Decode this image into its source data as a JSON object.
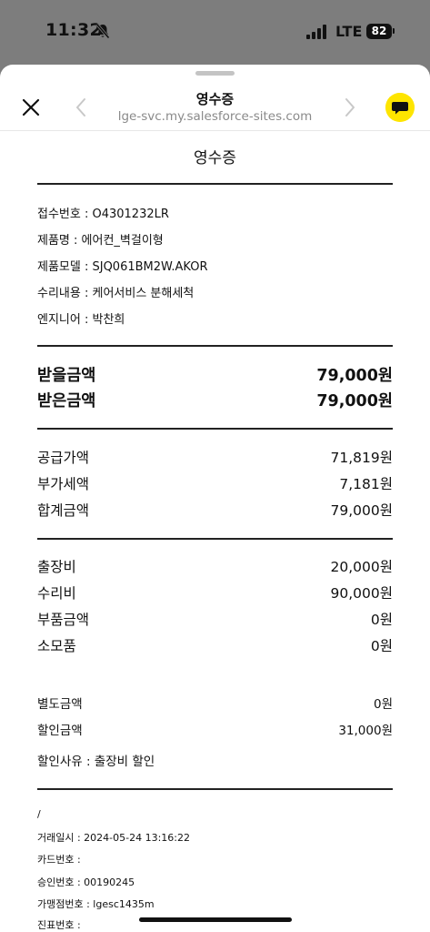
{
  "status": {
    "time": "11:32",
    "network": "LTE",
    "battery": "82"
  },
  "header": {
    "title": "영수증",
    "url": "lge-svc.my.salesforce-sites.com"
  },
  "receipt": {
    "title": "영수증",
    "info": [
      "접수번호 : O4301232LR",
      "제품명 : 에어컨_벽걸이형",
      "제품모델 : SJQ061BM2W.AKOR",
      "수리내용 : 케어서비스 분해세척",
      "엔지니어 : 박찬희"
    ],
    "totals": [
      {
        "label": "받을금액",
        "value": "79,000원"
      },
      {
        "label": "받은금액",
        "value": "79,000원"
      }
    ],
    "tax": [
      {
        "label": "공급가액",
        "value": "71,819원"
      },
      {
        "label": "부가세액",
        "value": "7,181원"
      },
      {
        "label": "합계금액",
        "value": "79,000원"
      }
    ],
    "costs": [
      {
        "label": "출장비",
        "value": "20,000원"
      },
      {
        "label": "수리비",
        "value": "90,000원"
      },
      {
        "label": "부품금액",
        "value": "0원"
      },
      {
        "label": "소모품",
        "value": "0원"
      }
    ],
    "extra": [
      {
        "label": "별도금액",
        "value": "0원"
      },
      {
        "label": "할인금액",
        "value": "31,000원"
      }
    ],
    "discount_reason": "할인사유 : 출장비 할인",
    "transaction": [
      "/",
      "거래일시 : 2024-05-24 13:16:22",
      "카드번호 :",
      "승인번호 : 00190245",
      "가맹점번호 : lgesc1435m",
      "진표번호 :"
    ]
  }
}
